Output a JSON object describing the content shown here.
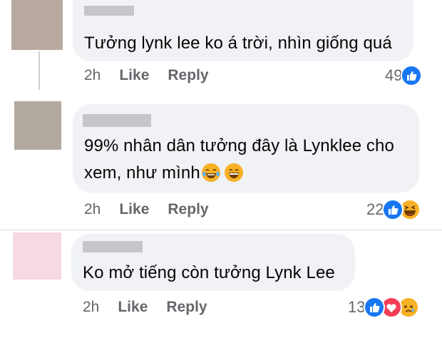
{
  "comments": [
    {
      "text": "Tưởng lynk lee ko á trời, nhìn giống quá",
      "time": "2h",
      "like_label": "Like",
      "reply_label": "Reply",
      "reaction_count": "49",
      "reactions": [
        "like-icon"
      ],
      "avatar_color": "#b8a9a0"
    },
    {
      "text": "99% nhân dân tưởng đây là Lynklee cho",
      "text_line2": "xem, như mình",
      "inline_emojis": [
        "laughing-tears-emoji",
        "grinning-emoji"
      ],
      "time": "2h",
      "like_label": "Like",
      "reply_label": "Reply",
      "reaction_count": "22",
      "reactions": [
        "like-icon",
        "haha-icon"
      ],
      "avatar_color": "#b2aaa0"
    },
    {
      "text": "Ko mở tiếng còn tưởng Lynk Lee",
      "time": "2h",
      "like_label": "Like",
      "reply_label": "Reply",
      "reaction_count": "13",
      "reactions": [
        "like-icon",
        "love-icon",
        "sad-icon"
      ],
      "avatar_color": "#f6d9e1"
    }
  ],
  "colors": {
    "bubble": "#f0f2f5",
    "meta_text": "#65676b",
    "like_blue": "#1877f2",
    "love_red": "#f33e58",
    "emoji_yellow": "#f7b125"
  }
}
